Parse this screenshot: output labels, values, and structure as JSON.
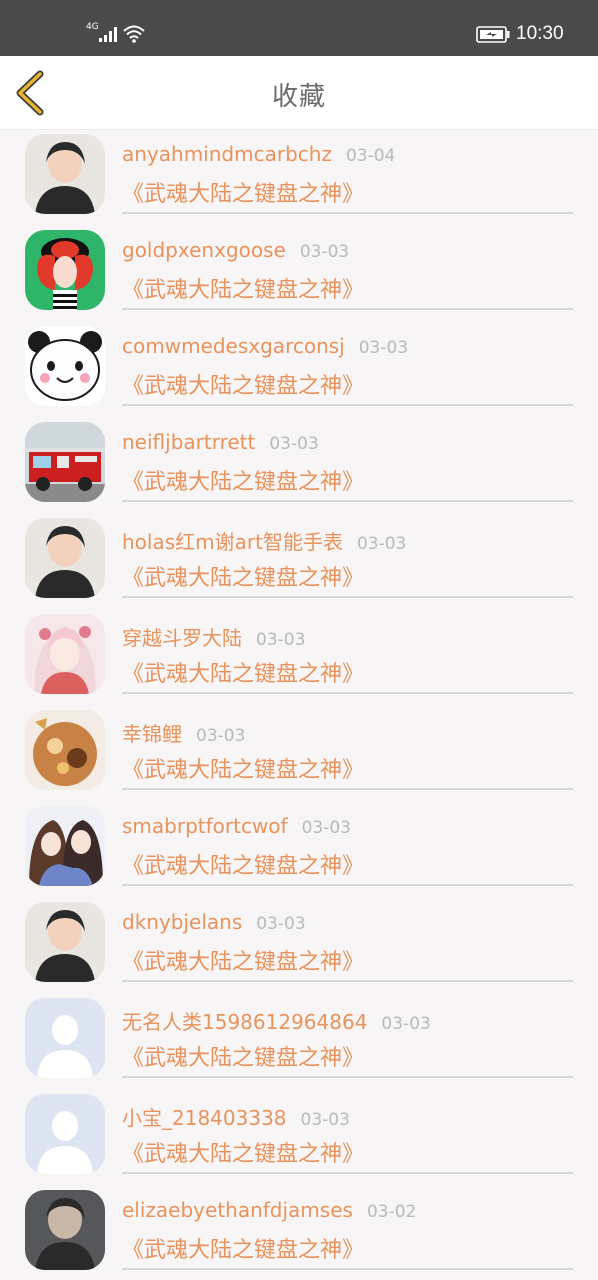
{
  "status_bar": {
    "network": "4G",
    "time": "10:30"
  },
  "header": {
    "title": "收藏",
    "back_icon": "chevron-left-icon"
  },
  "colors": {
    "accent": "#e8935b",
    "date": "#b9b9b9",
    "back_icon": "#e6b62f"
  },
  "favorites": [
    {
      "user": "anyahmindmcarbchz",
      "date": "03-04",
      "title": "《武魂大陆之键盘之神》",
      "avatar": "photo-portrait"
    },
    {
      "user": "goldpxenxgoose",
      "date": "03-03",
      "title": "《武魂大陆之键盘之神》",
      "avatar": "cartoon-face"
    },
    {
      "user": "comwmedesxgarconsj",
      "date": "03-03",
      "title": "《武魂大陆之键盘之神》",
      "avatar": "panda-face"
    },
    {
      "user": "neifljbartrrett",
      "date": "03-03",
      "title": "《武魂大陆之键盘之神》",
      "avatar": "fire-truck"
    },
    {
      "user": "holas红m谢art智能手表",
      "date": "03-03",
      "title": "《武魂大陆之键盘之神》",
      "avatar": "photo-portrait"
    },
    {
      "user": "穿越斗罗大陆",
      "date": "03-03",
      "title": "《武魂大陆之键盘之神》",
      "avatar": "anime-girl"
    },
    {
      "user": "幸锦鲤",
      "date": "03-03",
      "title": "《武魂大陆之键盘之神》",
      "avatar": "warm-photo"
    },
    {
      "user": "smabrptfortcwof",
      "date": "03-03",
      "title": "《武魂大陆之键盘之神》",
      "avatar": "anime-couple"
    },
    {
      "user": "dknybjelans",
      "date": "03-03",
      "title": "《武魂大陆之键盘之神》",
      "avatar": "photo-portrait"
    },
    {
      "user": "无名人类1598612964864",
      "date": "03-03",
      "title": "《武魂大陆之键盘之神》",
      "avatar": "default-user"
    },
    {
      "user": "小宝_218403338",
      "date": "03-03",
      "title": "《武魂大陆之键盘之神》",
      "avatar": "default-user"
    },
    {
      "user": "elizaebyethanfdjamses",
      "date": "03-02",
      "title": "《武魂大陆之键盘之神》",
      "avatar": "photo-portrait"
    }
  ]
}
